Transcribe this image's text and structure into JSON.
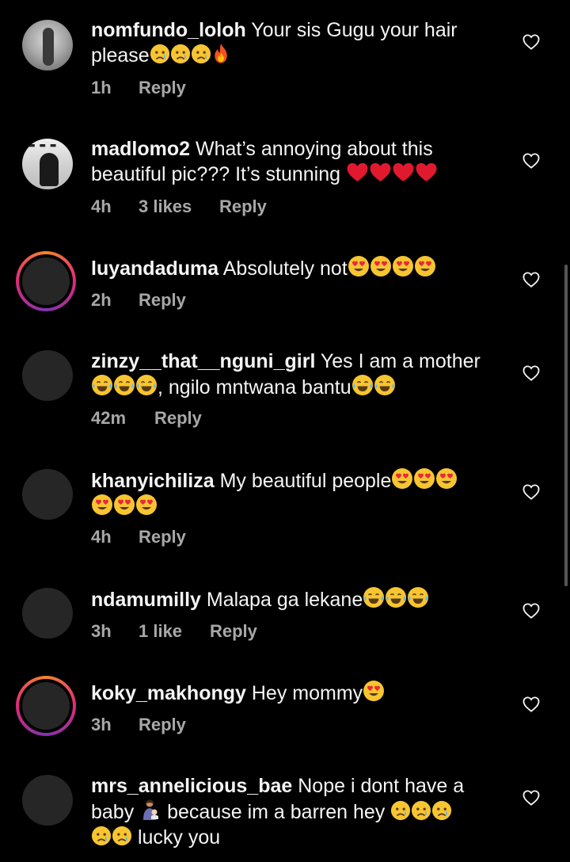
{
  "comments": [
    {
      "username": "nomfundo_loloh",
      "text": "Your sis Gugu your hair please",
      "emojis": [
        "crying-face",
        "crying-face",
        "crying-face",
        "fire"
      ],
      "time": "1h",
      "likes": "",
      "reply": "Reply",
      "avatar": "photo"
    },
    {
      "username": "madlomo2",
      "text": "What’s annoying about this beautiful pic??? It’s stunning",
      "emojis": [
        "red-heart",
        "red-heart",
        "red-heart",
        "red-heart"
      ],
      "time": "4h",
      "likes": "3 likes",
      "reply": "Reply",
      "avatar": "photo"
    },
    {
      "username": "luyandaduma",
      "text": "Absolutely not",
      "emojis": [
        "heart-eyes",
        "heart-eyes",
        "heart-eyes",
        "heart-eyes"
      ],
      "time": "2h",
      "likes": "",
      "reply": "Reply",
      "avatar": "story-ring"
    },
    {
      "username": "zinzy__that__nguni_girl",
      "text": "Yes I am a mother",
      "text2": ", ngilo mntwana bantu",
      "emojis": [
        "tears-of-joy",
        "tears-of-joy",
        "tears-of-joy"
      ],
      "emojis2": [
        "tears-of-joy",
        "tears-of-joy"
      ],
      "time": "42m",
      "likes": "",
      "reply": "Reply",
      "avatar": "placeholder"
    },
    {
      "username": "khanyichiliza",
      "text": "My beautiful people",
      "emojis": [
        "heart-eyes",
        "heart-eyes",
        "heart-eyes",
        "heart-eyes",
        "heart-eyes",
        "heart-eyes"
      ],
      "time": "4h",
      "likes": "",
      "reply": "Reply",
      "avatar": "placeholder"
    },
    {
      "username": "ndamumilly",
      "text": "Malapa ga lekane",
      "emojis": [
        "tears-of-joy",
        "tears-of-joy",
        "tears-of-joy"
      ],
      "time": "3h",
      "likes": "1 like",
      "reply": "Reply",
      "avatar": "placeholder"
    },
    {
      "username": "koky_makhongy",
      "text": "Hey mommy",
      "emojis": [
        "heart-eyes"
      ],
      "time": "3h",
      "likes": "",
      "reply": "Reply",
      "avatar": "story-ring"
    },
    {
      "username": "mrs_annelicious_bae",
      "text": "Nope i dont have a baby",
      "text2": "because im a barren hey",
      "text3": "lucky you",
      "emojis": [
        "person-feeding-baby"
      ],
      "emojis2": [
        "crying-face",
        "crying-face",
        "crying-face",
        "crying-face",
        "crying-face"
      ],
      "time": "",
      "likes": "",
      "reply": "",
      "avatar": "placeholder"
    }
  ],
  "colors": {
    "background": "#000000",
    "text": "#f5f5f5",
    "meta": "#a8a8a8",
    "avatar_placeholder": "#262626"
  }
}
